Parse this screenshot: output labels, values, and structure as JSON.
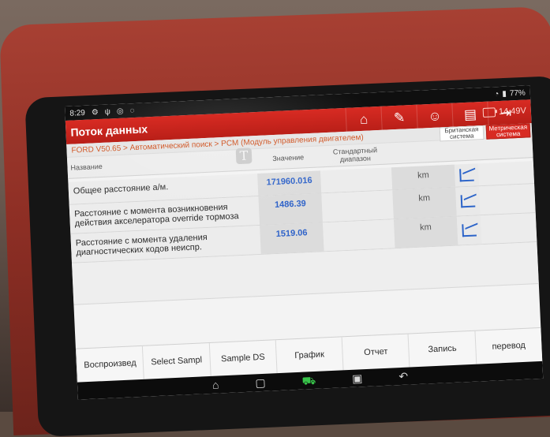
{
  "status": {
    "time": "8:29",
    "left_icons": [
      "settings-icon",
      "usb-icon",
      "headset-icon",
      "chat-icon"
    ],
    "battery": "77%"
  },
  "header": {
    "title": "Поток данных",
    "icons": [
      "home-icon",
      "edit-icon",
      "profile-icon",
      "print-icon",
      "exit-icon"
    ],
    "voltage": "14.49V"
  },
  "breadcrumb": "FORD V50.65 > Автоматический поиск > PCM (Модуль управления двигателем)",
  "units": {
    "british": "Британская система",
    "metric": "Метрическая система"
  },
  "table": {
    "headers": {
      "name": "Название",
      "value": "Значение",
      "range": "Стандартный диапазон"
    },
    "rows": [
      {
        "name": "Общее расстояние а/м.",
        "value": "171960.016",
        "range": "",
        "unit": "km"
      },
      {
        "name": "Расстояние с момента возникновения действия акселератора override тормоза",
        "value": "1486.39",
        "range": "",
        "unit": "km"
      },
      {
        "name": "Расстояние с момента удаления диагностических кодов неиспр.",
        "value": "1519.06",
        "range": "",
        "unit": "km"
      }
    ]
  },
  "bottom_buttons": [
    "Воспроизвед",
    "Select Sampl",
    "Sample DS",
    "График",
    "Отчет",
    "Запись",
    "перевод"
  ],
  "navbar": [
    "home-icon",
    "recent-apps-icon",
    "vehicle-icon",
    "gallery-icon",
    "back-icon"
  ],
  "colors": {
    "accent_red": "#d82b23",
    "value_blue": "#2f63c9"
  }
}
